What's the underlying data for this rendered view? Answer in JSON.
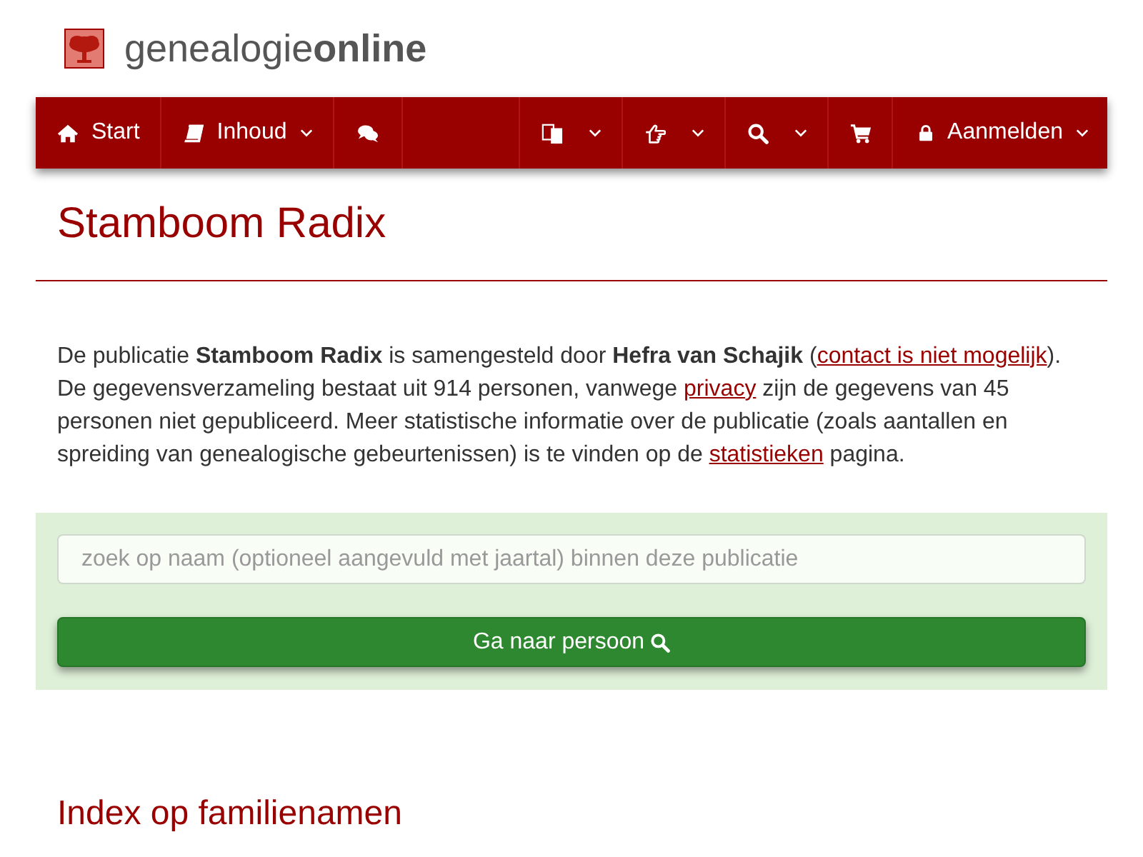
{
  "header": {
    "brand": "genealogie**online**"
  },
  "navbar": {
    "left": [
      {
        "label": "Start",
        "dropdown": false
      },
      {
        "label": "Inhoud",
        "dropdown": true
      },
      {
        "dropdown": false
      }
    ],
    "right": [
      {
        "dropdown": true
      },
      {
        "dropdown": true
      },
      {
        "dropdown": true
      },
      {
        "dropdown": false
      },
      {
        "label": "Aanmelden",
        "dropdown": true
      }
    ]
  },
  "page_title": "Stamboom Radix",
  "description": [
    {
      "kind": "text",
      "text": "De publicatie **Stamboom Radix** is samengesteld door **Hefra van Schajik** ("
    },
    {
      "kind": "link",
      "text": "contact is niet mogelijk"
    },
    {
      "kind": "text",
      "text": "). De gegevensverzameling bestaat uit 914 personen, vanwege "
    },
    {
      "kind": "link",
      "text": "privacy"
    },
    {
      "kind": "text",
      "text": " zijn de gegevens van 45 personen niet gepubliceerd. Meer statistische informatie over de publicatie (zoals aantallen en spreiding van genealogische gebeurtenissen) is te vinden op de "
    },
    {
      "kind": "link",
      "text": "statistieken"
    },
    {
      "kind": "text",
      "text": " pagina."
    }
  ],
  "search": {
    "placeholder": "zoek op naam (optioneel aangevuld met jaartal) binnen deze publicatie",
    "button": "Ga naar persoon"
  },
  "section_heading": "Index op familienamen"
}
